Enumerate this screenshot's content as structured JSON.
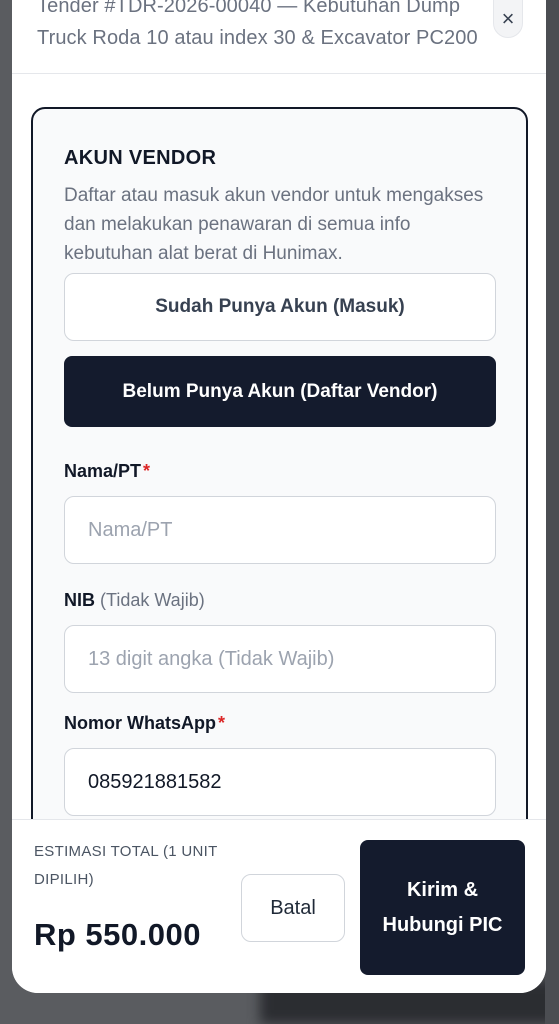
{
  "header": {
    "title": "Tender #TDR-2026-00040 — Kebutuhan Dump Truck Roda 10 atau index 30 & Excavator PC200",
    "close_symbol": "×"
  },
  "vendor_card": {
    "title": "AKUN VENDOR",
    "description": "Daftar atau masuk akun vendor untuk mengakses dan melakukan penawaran di semua info kebutuhan alat berat di Hunimax.",
    "login_button": "Sudah Punya Akun (Masuk)",
    "register_button": "Belum Punya Akun (Daftar Vendor)"
  },
  "form": {
    "name": {
      "label": "Nama/PT",
      "required_mark": "*",
      "placeholder": "Nama/PT",
      "value": ""
    },
    "nib": {
      "label": "NIB",
      "optional_note": "(Tidak Wajib)",
      "placeholder": "13 digit angka (Tidak Wajib)",
      "value": ""
    },
    "whatsapp": {
      "label": "Nomor WhatsApp",
      "required_mark": "*",
      "placeholder": "",
      "value": "085921881582"
    }
  },
  "footer": {
    "estimate_label": "ESTIMASI TOTAL (1 UNIT DIPILIH)",
    "estimate_total": "Rp 550.000",
    "cancel_button": "Batal",
    "submit_button": "Kirim & Hubungi PIC"
  },
  "colors": {
    "primary_dark": "#141b2d",
    "required_red": "#dc2626",
    "muted_text": "#6b7280"
  }
}
